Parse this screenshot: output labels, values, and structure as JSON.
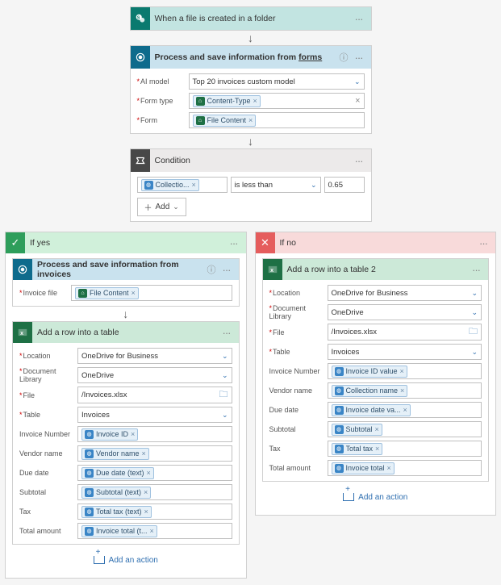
{
  "trigger": {
    "title": "When a file is created in a folder"
  },
  "ai_step": {
    "title": "Process and save information from ",
    "title_highlight": "forms",
    "fields": {
      "ai_model_label": "AI model",
      "ai_model_value": "Top 20 invoices custom model",
      "form_type_label": "Form type",
      "form_type_token": "Content-Type",
      "form_label": "Form",
      "form_token": "File Content"
    }
  },
  "condition": {
    "title": "Condition",
    "left_token": "Collectio...",
    "operator": "is less than",
    "value": "0.65",
    "add_label": "Add"
  },
  "yes": {
    "title": "If yes",
    "ai": {
      "title": "Process and save information from invoices",
      "field_label": "Invoice file",
      "field_token": "File Content"
    },
    "excel": {
      "title": "Add a row into a table",
      "location_label": "Location",
      "location_value": "OneDrive for Business",
      "lib_label": "Document Library",
      "lib_value": "OneDrive",
      "file_label": "File",
      "file_value": "/Invoices.xlsx",
      "table_label": "Table",
      "table_value": "Invoices",
      "inv_label": "Invoice Number",
      "inv_token": "Invoice ID",
      "vendor_label": "Vendor name",
      "vendor_token": "Vendor name",
      "due_label": "Due date",
      "due_token": "Due date (text)",
      "sub_label": "Subtotal",
      "sub_token": "Subtotal (text)",
      "tax_label": "Tax",
      "tax_token": "Total tax (text)",
      "total_label": "Total amount",
      "total_token": "Invoice total (t..."
    },
    "add_action": "Add an action"
  },
  "no": {
    "title": "If no",
    "excel": {
      "title": "Add a row into a table 2",
      "location_label": "Location",
      "location_value": "OneDrive for Business",
      "lib_label": "Document Library",
      "lib_value": "OneDrive",
      "file_label": "File",
      "file_value": "/Invoices.xlsx",
      "table_label": "Table",
      "table_value": "Invoices",
      "inv_label": "Invoice Number",
      "inv_token": "Invoice ID value",
      "vendor_label": "Vendor name",
      "vendor_token": "Collection name",
      "due_label": "Due date",
      "due_token": "Invoice date va...",
      "sub_label": "Subtotal",
      "sub_token": "Subtotal",
      "tax_label": "Tax",
      "tax_token": "Total tax",
      "total_label": "Total amount",
      "total_token": "Invoice total"
    },
    "add_action": "Add an action"
  }
}
